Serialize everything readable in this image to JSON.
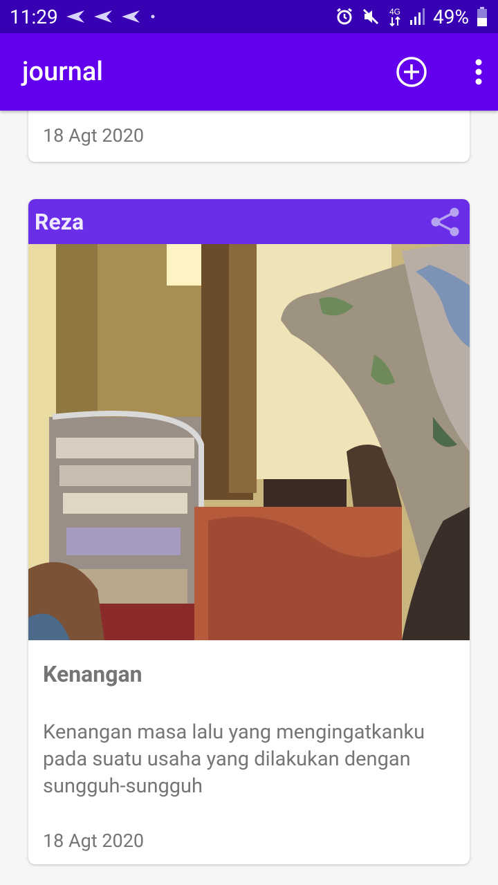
{
  "status_bar": {
    "time": "11:29",
    "battery": "49%",
    "network": "4G",
    "icons": [
      "send-icon",
      "send-icon",
      "send-icon",
      "alarm-icon",
      "mute-icon",
      "signal-icon",
      "battery-icon"
    ]
  },
  "app_bar": {
    "title": "journal",
    "add_icon": "add-circle-icon",
    "more_icon": "more-vert-icon"
  },
  "colors": {
    "status_bar": "#3700b3",
    "app_bar": "#6200ee",
    "card_header": "#6a2ee8"
  },
  "entries": [
    {
      "date": "18 Agt 2020"
    },
    {
      "author": "Reza",
      "share_icon": "share-icon",
      "title": "Kenangan",
      "body": "Kenangan masa lalu yang mengingatkanku pada suatu usaha yang dilakukan dengan sungguh-sungguh",
      "date": "18 Agt 2020"
    }
  ]
}
